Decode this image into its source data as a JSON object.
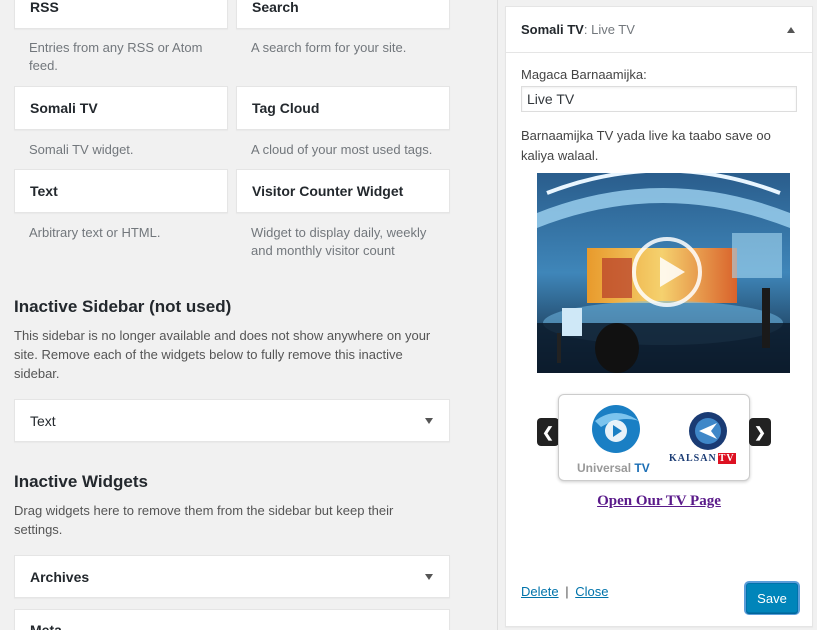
{
  "available_widgets": [
    {
      "name": "RSS",
      "description": "Entries from any RSS or Atom feed."
    },
    {
      "name": "Search",
      "description": "A search form for your site."
    },
    {
      "name": "Somali TV",
      "description": "Somali TV widget."
    },
    {
      "name": "Tag Cloud",
      "description": "A cloud of your most used tags."
    },
    {
      "name": "Text",
      "description": "Arbitrary text or HTML."
    },
    {
      "name": "Visitor Counter Widget",
      "description": "Widget to display daily, weekly and monthly visitor count"
    }
  ],
  "inactive_sidebar": {
    "title": "Inactive Sidebar (not used)",
    "description": "This sidebar is no longer available and does not show anywhere on your site. Remove each of the widgets below to fully remove this inactive sidebar.",
    "widget": "Text"
  },
  "inactive_widgets": {
    "title": "Inactive Widgets",
    "description": "Drag widgets here to remove them from the sidebar but keep their settings.",
    "widgets": [
      "Archives",
      "Meta"
    ]
  },
  "widget_panel": {
    "title": "Somali TV",
    "subtitle": ": Live TV",
    "field_label": "Magaca Barnaamijka:",
    "field_value": "Live TV",
    "description": "Barnaamijka TV yada live ka taabo save oo kaliya walaal.",
    "carousel_prev": "❮",
    "carousel_next": "❯",
    "logo1_text_a": "Universal ",
    "logo1_text_b": "TV",
    "logo2_text_a": "KALSAN",
    "logo2_text_b": "TV",
    "link_text": "Open Our TV Page",
    "delete_label": "Delete",
    "separator": "|",
    "close_label": "Close",
    "save_label": "Save"
  },
  "colors": {
    "primary_button": "#0085ba",
    "link": "#0073aa",
    "tv_link": "#5a1a8a"
  }
}
